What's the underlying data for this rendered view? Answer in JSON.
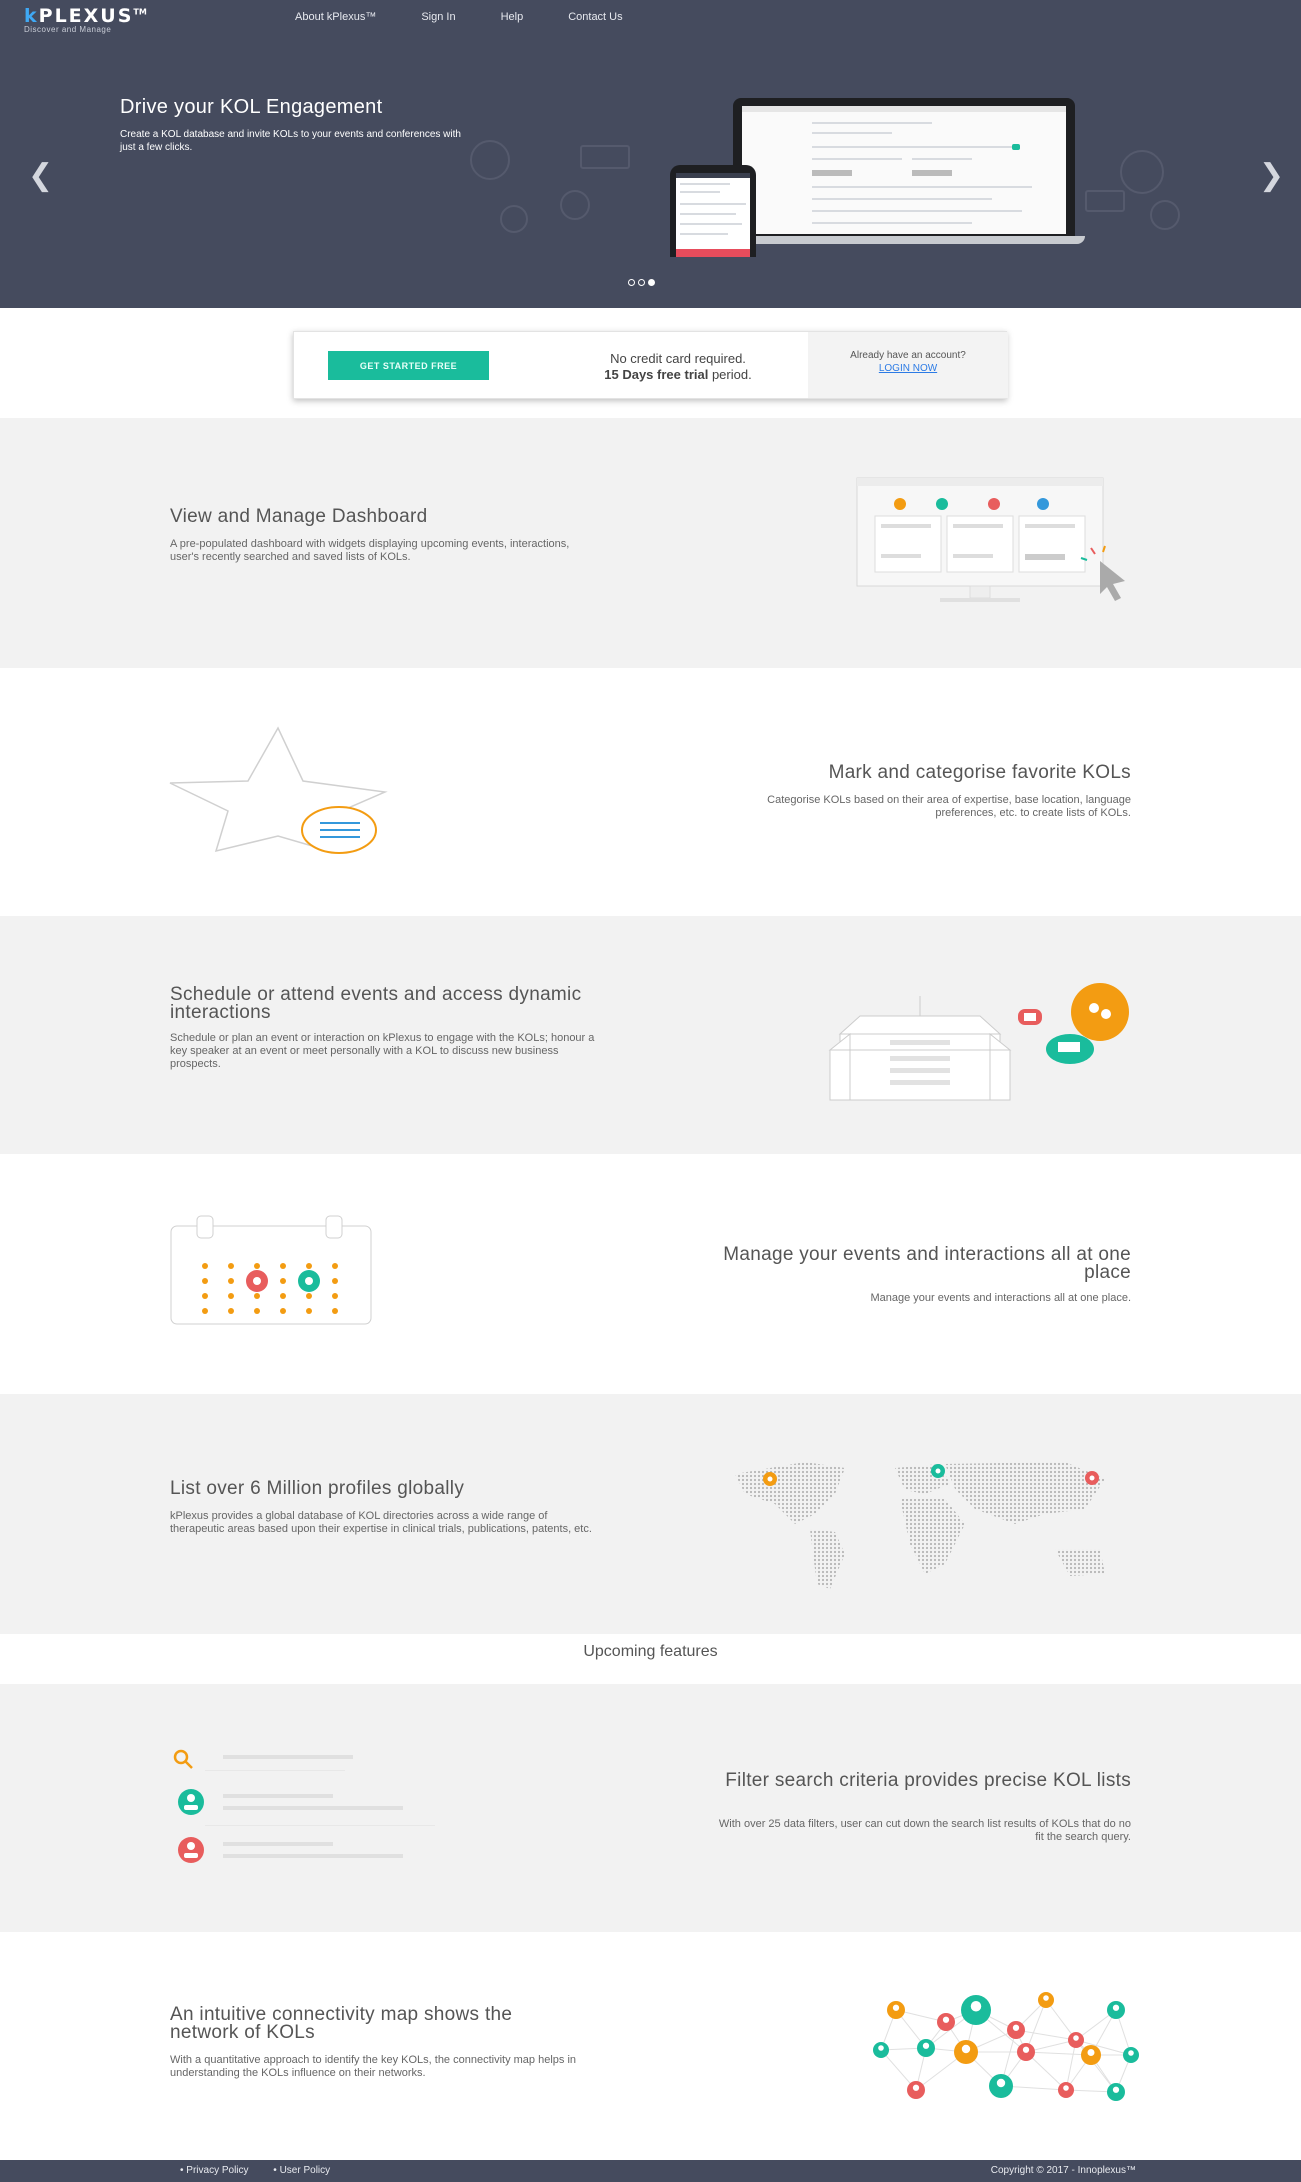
{
  "header": {
    "brand": "PLEXUS",
    "brand_initial": "k",
    "brand_tm": "TM",
    "tagline": "Discover and Manage",
    "nav": [
      "About kPlexus™",
      "Sign In",
      "Help",
      "Contact Us"
    ]
  },
  "hero": {
    "title": "Drive your KOL Engagement",
    "subtitle": "Create a KOL database and invite KOLs to your events and conferences with just a few clicks.",
    "prev_arrow": "❮",
    "next_arrow": "❯",
    "slides_total": 3,
    "slide_active": 3
  },
  "cta": {
    "button": "GET STARTED FREE",
    "line1": "No credit card required.",
    "line2_bold": "15 Days free trial",
    "line2_rest": " period.",
    "account_q": "Already have an account?",
    "login": "LOGIN NOW"
  },
  "features": [
    {
      "title": "View and Manage Dashboard",
      "desc": "A pre-populated dashboard with widgets displaying upcoming events, interactions, user's recently searched and saved lists of KOLs."
    },
    {
      "title": "Mark and categorise favorite KOLs",
      "desc": "Categorise KOLs based on their area of expertise, base location, language preferences, etc. to create lists of KOLs."
    },
    {
      "title": "Schedule or attend events and access dynamic interactions",
      "desc": "Schedule or plan an event or interaction on kPlexus to engage with the KOLs; honour a key speaker at an event or meet personally with a KOL to discuss new business prospects."
    },
    {
      "title": "Manage your events and interactions all at one place",
      "desc": "Manage your events and interactions all at one place."
    },
    {
      "title": "List over 6 Million profiles globally",
      "desc": "kPlexus provides a global database of KOL directories across a wide range of therapeutic areas based upon their expertise in clinical trials, publications, patents, etc."
    }
  ],
  "upcoming_heading": "Upcoming features",
  "upcoming": [
    {
      "title": "Filter search criteria provides precise KOL lists",
      "desc": "With over 25 data filters, user can cut down the search list results of KOLs that do no fit the search query."
    },
    {
      "title": "An intuitive connectivity map shows the network of KOLs",
      "desc": "With a quantitative approach to identify the key KOLs, the connectivity map helps in understanding the KOLs influence on their networks."
    }
  ],
  "footer": {
    "links": [
      "• Privacy Policy",
      "• User Policy"
    ],
    "copyright": "Copyright © 2017 - Innoplexus™"
  },
  "colors": {
    "hero_bg": "#454b5e",
    "accent": "#1abc9c",
    "orange": "#f39c12",
    "red": "#e85d5d",
    "teal": "#1abc9c",
    "section_grey": "#f2f2f2"
  },
  "icons": [
    "chevron-left-icon",
    "chevron-right-icon",
    "star-icon",
    "search-icon",
    "user-icon",
    "calendar-icon",
    "world-map-icon",
    "building-icon",
    "chat-icon",
    "cursor-icon"
  ]
}
